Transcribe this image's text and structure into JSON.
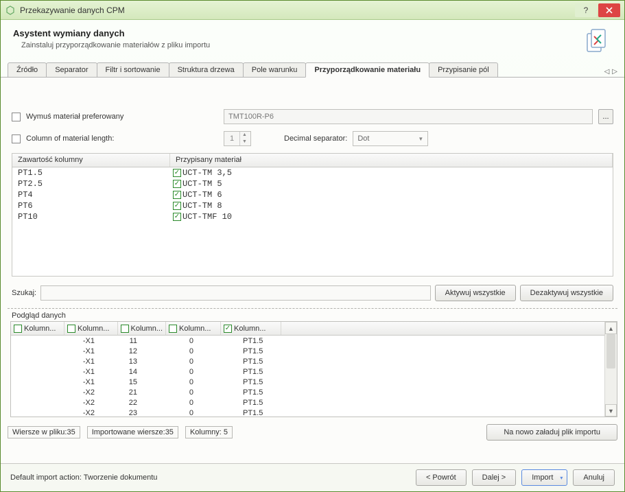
{
  "titlebar": {
    "title": "Przekazywanie danych CPM"
  },
  "header": {
    "title": "Asystent wymiany danych",
    "subtitle": "Zainstaluj przyporządkowanie materiałów z pliku importu"
  },
  "tabs": [
    {
      "label": "Źródło",
      "active": false
    },
    {
      "label": "Separator",
      "active": false
    },
    {
      "label": "Filtr i sortowanie",
      "active": false
    },
    {
      "label": "Struktura drzewa",
      "active": false
    },
    {
      "label": "Pole warunku",
      "active": false
    },
    {
      "label": "Przyporządkowanie materiału",
      "active": true
    },
    {
      "label": "Przypisanie pól",
      "active": false
    }
  ],
  "form": {
    "force_material_label": "Wymuś materiał preferowany",
    "force_material_value": "TMT100R-P6",
    "col_length_label": "Column of material length:",
    "col_length_value": "1",
    "decimal_label": "Decimal separator:",
    "decimal_value": "Dot"
  },
  "material_table": {
    "headers": {
      "col1": "Zawartość kolumny",
      "col2": "Przypisany materiał"
    },
    "rows": [
      {
        "content": "PT1.5",
        "material": "UCT-TM 3,5"
      },
      {
        "content": "PT2.5",
        "material": "UCT-TM 5"
      },
      {
        "content": "PT4",
        "material": "UCT-TM 6"
      },
      {
        "content": "PT6",
        "material": "UCT-TM 8"
      },
      {
        "content": "PT10",
        "material": "UCT-TMF 10"
      }
    ]
  },
  "search": {
    "label": "Szukaj:",
    "activate_all": "Aktywuj wszystkie",
    "deactivate_all": "Dezaktywuj wszystkie"
  },
  "preview": {
    "label": "Podgląd danych",
    "headers": [
      {
        "label": "Kolumn...",
        "checked": false
      },
      {
        "label": "Kolumn...",
        "checked": false
      },
      {
        "label": "Kolumn...",
        "checked": false
      },
      {
        "label": "Kolumn...",
        "checked": false
      },
      {
        "label": "Kolumn...",
        "checked": true
      }
    ],
    "rows": [
      {
        "c1": "",
        "c2": "-X1",
        "c3": "11",
        "c4": "0",
        "c5": "PT1.5"
      },
      {
        "c1": "",
        "c2": "-X1",
        "c3": "12",
        "c4": "0",
        "c5": "PT1.5"
      },
      {
        "c1": "",
        "c2": "-X1",
        "c3": "13",
        "c4": "0",
        "c5": "PT1.5"
      },
      {
        "c1": "",
        "c2": "-X1",
        "c3": "14",
        "c4": "0",
        "c5": "PT1.5"
      },
      {
        "c1": "",
        "c2": "-X1",
        "c3": "15",
        "c4": "0",
        "c5": "PT1.5"
      },
      {
        "c1": "",
        "c2": "-X2",
        "c3": "21",
        "c4": "0",
        "c5": "PT1.5"
      },
      {
        "c1": "",
        "c2": "-X2",
        "c3": "22",
        "c4": "0",
        "c5": "PT1.5"
      },
      {
        "c1": "",
        "c2": "-X2",
        "c3": "23",
        "c4": "0",
        "c5": "PT1.5"
      }
    ]
  },
  "status": {
    "rows_in_file": "Wiersze w pliku:35",
    "rows_imported": "Importowane wiersze:35",
    "columns": "Kolumny: 5",
    "reload": "Na nowo załaduj plik importu"
  },
  "footer": {
    "default_action": "Default import action: Tworzenie dokumentu",
    "back": "<  Powrót",
    "next": "Dalej  >",
    "import": "Import",
    "cancel": "Anuluj"
  }
}
